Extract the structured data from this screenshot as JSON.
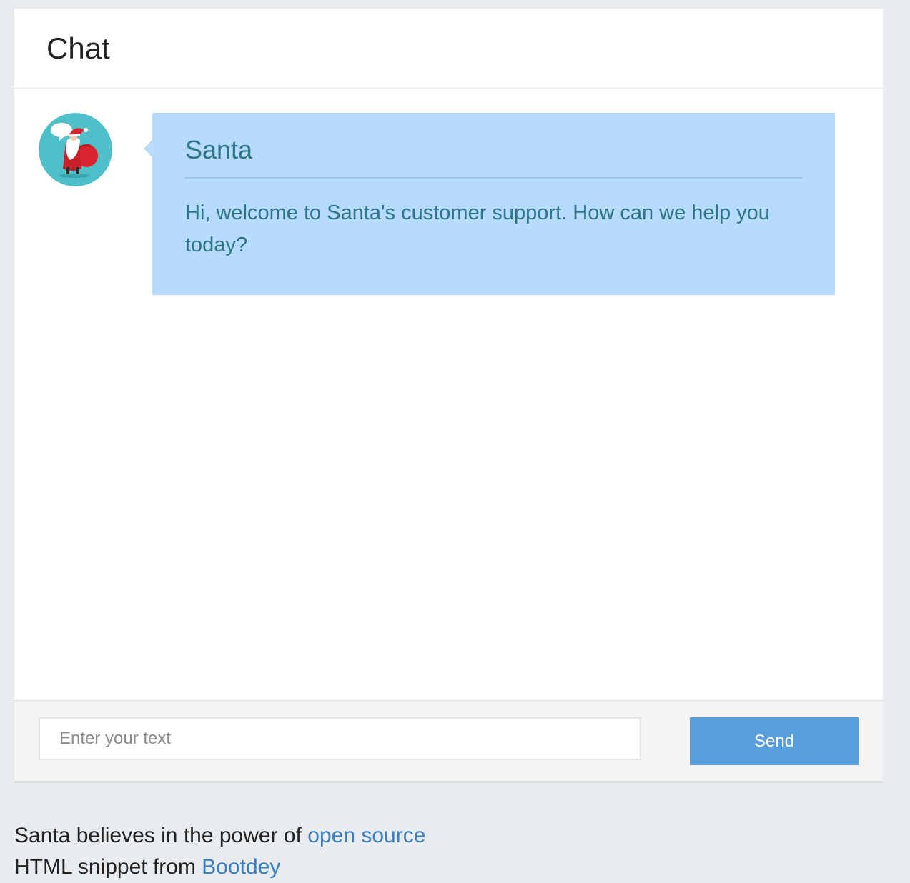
{
  "panel": {
    "title": "Chat"
  },
  "message": {
    "avatar_icon": "santa-avatar-icon",
    "sender": "Santa",
    "text": "Hi, welcome to Santa's customer support. How can we help you today?"
  },
  "composer": {
    "placeholder": "Enter your text",
    "value": "",
    "send_label": "Send"
  },
  "credits": {
    "line1_prefix": "Santa believes in the power of ",
    "line1_link": "open source",
    "line2_prefix": "HTML snippet from ",
    "line2_link": "Bootdey"
  },
  "colors": {
    "page_background": "#e9ecef",
    "bubble_background": "#b6dbfb",
    "bubble_text": "#2e7585",
    "send_button": "#5a9ddb",
    "link": "#3a7ec0"
  }
}
